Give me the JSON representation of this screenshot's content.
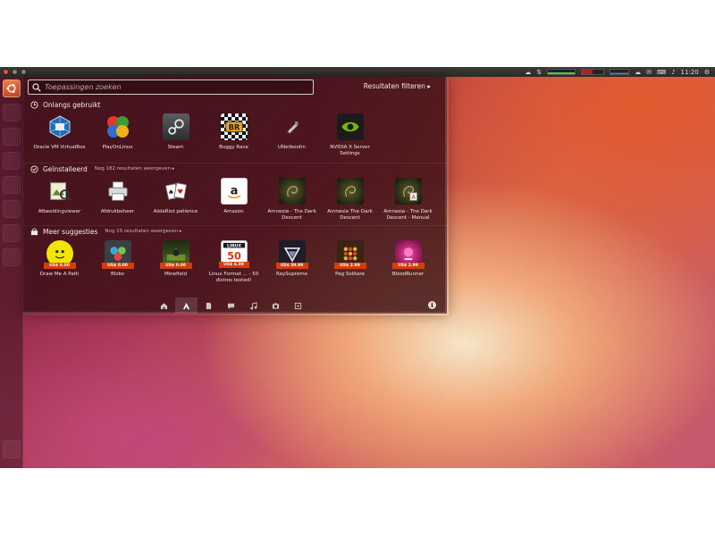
{
  "panel": {
    "clock": "11:20"
  },
  "search": {
    "placeholder": "Toepassingen zoeken",
    "value": ""
  },
  "filter": {
    "label": "Resultaten filteren ▸"
  },
  "sections": {
    "recent": {
      "title": "Onlangs gebruikt",
      "items": [
        {
          "label": "Oracle VM VirtualBox",
          "icon": "virtualbox-icon"
        },
        {
          "label": "PlayOnLinux",
          "icon": "playonlinux-icon"
        },
        {
          "label": "Steam",
          "icon": "steam-icon"
        },
        {
          "label": "Buggy Race",
          "icon": "buggy-race-icon"
        },
        {
          "label": "UNetbootin",
          "icon": "unetbootin-icon"
        },
        {
          "label": "NVIDIA X Server Settings",
          "icon": "nvidia-icon"
        }
      ]
    },
    "installed": {
      "title": "Geïnstalleerd",
      "more": "Nog 182 resultaten weergeven ▸",
      "items": [
        {
          "label": "Afbeeldingviewer",
          "icon": "image-viewer-icon"
        },
        {
          "label": "Afdrukbeheer",
          "icon": "printer-icon"
        },
        {
          "label": "AisleRiot patience",
          "icon": "cards-icon"
        },
        {
          "label": "Amazon",
          "icon": "amazon-icon"
        },
        {
          "label": "Amnesia - The Dark Descent",
          "icon": "amnesia-icon"
        },
        {
          "label": "Amnesia The Dark Descent",
          "icon": "amnesia-icon"
        },
        {
          "label": "Amnesia - The Dark Descent - Manual",
          "icon": "amnesia-manual-icon"
        }
      ]
    },
    "suggestions": {
      "title": "Meer suggesties",
      "more": "Nog 15 resultaten weergeven ▸",
      "items": [
        {
          "label": "Draw Me A Path",
          "price": "US$ 0.00",
          "icon": "draw-me-a-path-icon"
        },
        {
          "label": "Blobs",
          "price": "US$ 0.00",
          "icon": "blobs-icon"
        },
        {
          "label": "Minefield",
          "price": "US$ 0.00",
          "icon": "minefield-icon"
        },
        {
          "label": "Linux Format ... - 50 distros tested!",
          "price": "US$ 6.99",
          "icon": "linux-format-icon"
        },
        {
          "label": "RaySupreme",
          "price": "US$ 39.99",
          "icon": "raysupreme-icon"
        },
        {
          "label": "Peg Solitare",
          "price": "US$ 2.99",
          "icon": "peg-solitare-icon"
        },
        {
          "label": "BloodRunner",
          "price": "US$ 2.99",
          "icon": "bloodrunner-icon"
        }
      ]
    }
  },
  "lenses": [
    "home-icon",
    "applications-icon",
    "files-icon",
    "social-icon",
    "music-icon",
    "photos-icon",
    "video-icon"
  ],
  "colors": {
    "accent": "#dd4814",
    "price_badge": "#d33e0c"
  }
}
